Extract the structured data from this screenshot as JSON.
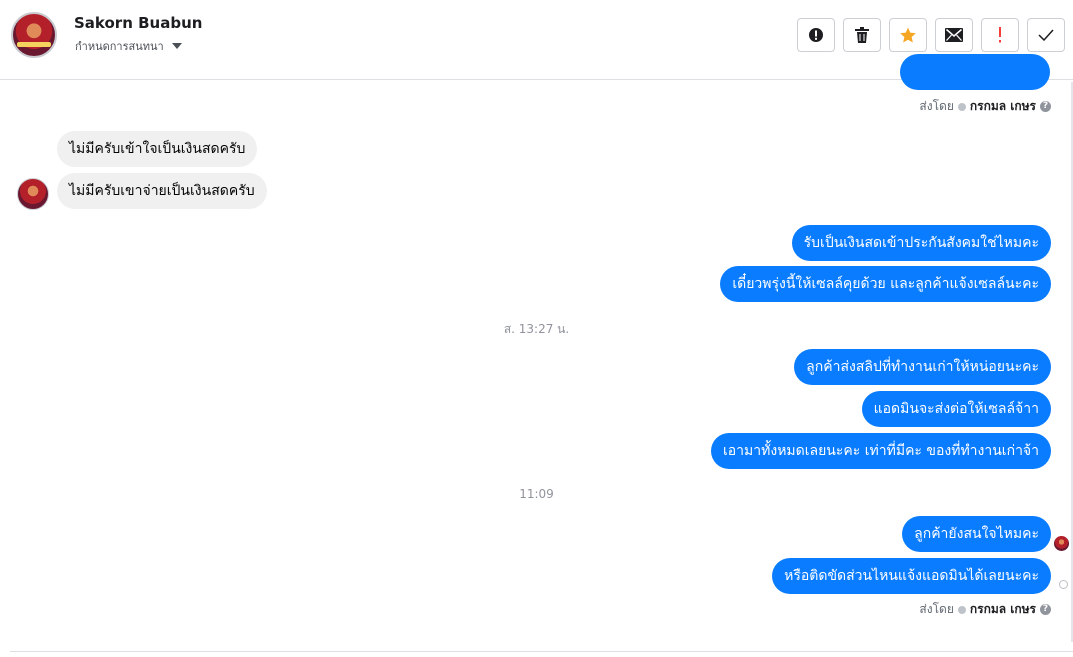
{
  "header": {
    "name": "Sakorn Buabun",
    "subtitle": "กำหนดการสนทนา",
    "toolbar": [
      {
        "icon": "alert-circle-icon",
        "name": "mark-spam-button"
      },
      {
        "icon": "trash-icon",
        "name": "delete-button"
      },
      {
        "icon": "star-icon",
        "name": "star-button"
      },
      {
        "icon": "envelope-icon",
        "name": "mark-unread-button"
      },
      {
        "icon": "exclamation-icon",
        "name": "follow-up-button"
      },
      {
        "icon": "check-icon",
        "name": "mark-done-button"
      }
    ]
  },
  "colors": {
    "outgoing": "#0a7cff",
    "incoming": "#f0f0f0",
    "star": "#f5a623",
    "alert": "#fa3e3e"
  },
  "conversation": {
    "sent_by_label": "ส่งโดย",
    "sent_by_name": "กรกมล เกษร",
    "incoming": [
      "ไม่มีครับเข้าใจเป็นเงินสดครับ",
      "ไม่มีครับเขาจ่ายเป็นเงินสดครับ"
    ],
    "outgoing_group1": [
      "รับเป็นเงินสดเข้าประกันสังคมใช่ไหมคะ",
      "เดี๋ยวพรุ่งนี้ให้เซลล์คุยด้วย และลูกค้าแจ้งเซลล์นะคะ"
    ],
    "timestamp1": "ส. 13:27 น.",
    "outgoing_group2": [
      "ลูกค้าส่งสลิปที่ทำงานเก่าให้หน่อยนะคะ",
      "แอดมินจะส่งต่อให้เซลล์จ้าา",
      "เอามาทั้งหมดเลยนะคะ เท่าที่มีคะ ของที่ทำงานเก่าจ้า"
    ],
    "timestamp2": "11:09",
    "outgoing_group3": [
      "ลูกค้ายังสนใจไหมคะ",
      "หรือติดขัดส่วนไหนแจ้งแอดมินได้เลยนะคะ"
    ]
  }
}
